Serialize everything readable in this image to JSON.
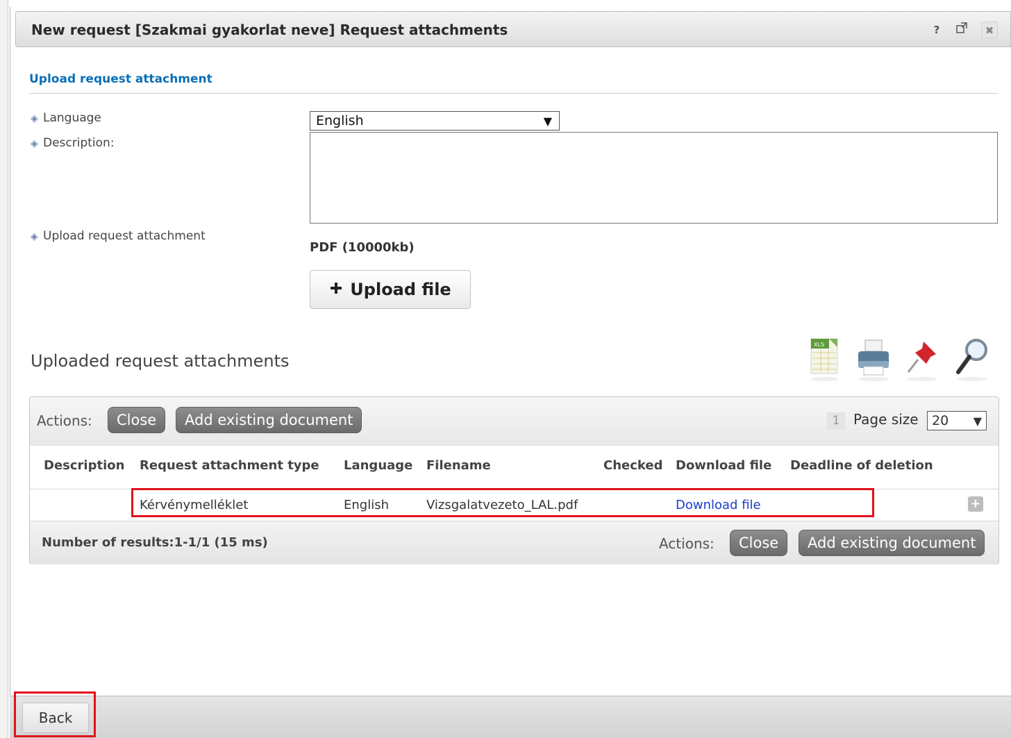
{
  "dialog": {
    "title": "New request [Szakmai gyakorlat neve] Request attachments",
    "help_label": "?",
    "close_label": "✖"
  },
  "form": {
    "section_title": "Upload request attachment",
    "language_label": "Language",
    "language_value": "English",
    "description_label": "Description:",
    "description_value": "",
    "upload_label": "Upload request attachment",
    "file_type_note": "PDF (10000kb)",
    "upload_button_label": "Upload file"
  },
  "uploaded": {
    "title": "Uploaded request attachments",
    "toolbar_icons": [
      "xls-export-icon",
      "print-icon",
      "pin-icon",
      "search-icon"
    ]
  },
  "grid": {
    "actions_label": "Actions:",
    "close_button": "Close",
    "add_existing_button": "Add existing document",
    "page_number": "1",
    "page_size_label": "Page size",
    "page_size_value": "20",
    "columns": [
      "Description",
      "Request attachment type",
      "Language",
      "Filename",
      "Checked",
      "Download file",
      "Deadline of deletion"
    ],
    "rows": [
      {
        "description": "",
        "type": "Kérvénymelléklet",
        "language": "English",
        "filename": "Vizsgalatvezeto_LAL.pdf",
        "checked": "",
        "download": "Download file",
        "deadline": ""
      }
    ],
    "results_text": "Number of results:1-1/1 (15 ms)",
    "bottom_actions_label": "Actions:",
    "bottom_close_button": "Close",
    "bottom_add_existing_button": "Add existing document"
  },
  "footer": {
    "back_button": "Back"
  },
  "colors": {
    "accent_link": "#0a6fb6",
    "highlight": "#e0121b",
    "download_link": "#1a3ec8"
  }
}
